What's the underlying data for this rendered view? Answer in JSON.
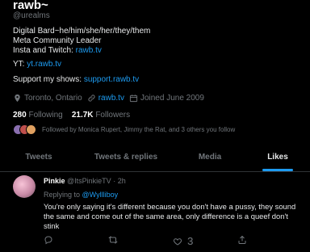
{
  "profile": {
    "display_name": "rawb~",
    "handle": "@urealms",
    "bio_lines": [
      "Digital Bard~he/him/she/her/they/them",
      "Meta Community Leader"
    ],
    "bio_insta_prefix": "Insta and Twitch: ",
    "bio_insta_link": "rawb.tv",
    "yt_prefix": "YT: ",
    "yt_link": "yt.rawb.tv",
    "shows_prefix": "Support my shows: ",
    "shows_link": "support.rawb.tv",
    "location": "Toronto, Ontario",
    "website": "rawb.tv",
    "joined": "Joined June 2009",
    "following_count": "280",
    "following_label": "Following",
    "followers_count": "21.7K",
    "followers_label": "Followers",
    "followed_by": "Followed by Monica Rupert, Jimmy the Rat, and 3 others you follow"
  },
  "tabs": [
    {
      "label": "Tweets"
    },
    {
      "label": "Tweets & replies"
    },
    {
      "label": "Media"
    },
    {
      "label": "Likes"
    }
  ],
  "active_tab": "Likes",
  "tweet": {
    "author_name": "Pinkie",
    "author_handle": "@ItsPinkieTV",
    "separator": " · ",
    "time": "2h",
    "reply_prefix": "Replying to ",
    "reply_handle": "@Wyllliboy",
    "text": "You're only saying it's different because you don't have a pussy, they sound the same and come out of the same area, only difference is a queef don't stink",
    "reply_count": "",
    "retweet_count": "",
    "like_count": "3"
  },
  "colors": {
    "background": "#000000",
    "accent": "#1d9bf0",
    "muted": "#71767b",
    "text": "#e7e9ea"
  },
  "icons": [
    "location-pin-icon",
    "link-icon",
    "calendar-icon",
    "reply-icon",
    "retweet-icon",
    "like-icon",
    "share-icon"
  ]
}
